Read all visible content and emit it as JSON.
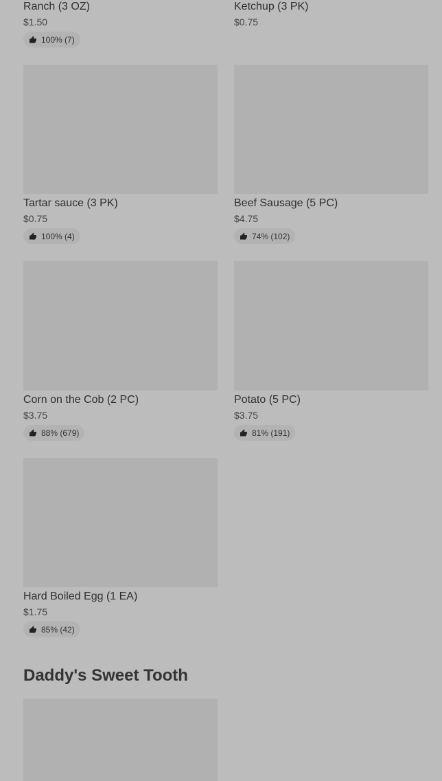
{
  "colors": {
    "page_background": "#bcbcbc",
    "thumbnail_placeholder": "#b1b1b1",
    "rating_pill": "#b3b3b3",
    "text": "#333333"
  },
  "icons": {
    "rating": "thumbs-up-icon"
  },
  "items": [
    {
      "name": "Ranch (3 OZ)",
      "price": "$1.50",
      "rating": "100% (7)"
    },
    {
      "name": "Ketchup (3 PK)",
      "price": "$0.75",
      "rating": ""
    },
    {
      "name": "Tartar sauce (3 PK)",
      "price": "$0.75",
      "rating": "100% (4)"
    },
    {
      "name": "Beef Sausage (5 PC)",
      "price": "$4.75",
      "rating": "74% (102)"
    },
    {
      "name": "Corn on the Cob (2 PC)",
      "price": "$3.75",
      "rating": "88% (679)"
    },
    {
      "name": "Potato (5 PC)",
      "price": "$3.75",
      "rating": "81% (191)"
    },
    {
      "name": "Hard Boiled Egg (1 EA)",
      "price": "$1.75",
      "rating": "85% (42)"
    }
  ],
  "section": {
    "title": "Daddy's Sweet Tooth"
  }
}
